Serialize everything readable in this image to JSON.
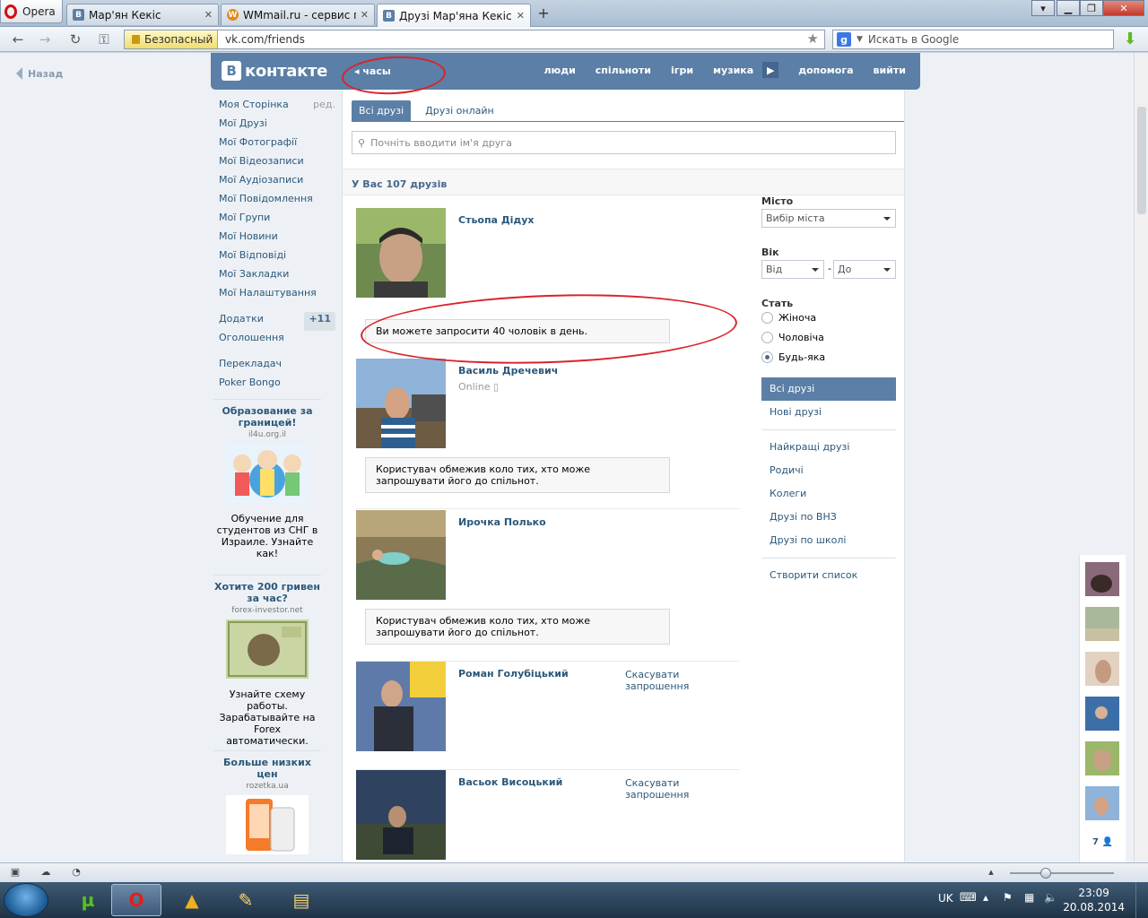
{
  "browser": {
    "menu_label": "Opera",
    "tabs": [
      {
        "title": "Мар'ян Кекіс",
        "favicon": "B"
      },
      {
        "title": "WMmail.ru - сервис п...",
        "favicon": "W"
      },
      {
        "title": "Друзі Мар'яна Кекіса |...",
        "favicon": "B"
      }
    ],
    "secure_label": "Безопасный",
    "url": "vk.com/friends",
    "search_placeholder": "Искать в Google"
  },
  "page": {
    "back_label": "Назад",
    "header": {
      "logo_letter": "B",
      "logo_text": "контакте",
      "status": "часы",
      "nav": [
        "люди",
        "спільноти",
        "ігри",
        "музика",
        "допомога",
        "вийти"
      ]
    },
    "sidebar": {
      "items": [
        {
          "label": "Моя Сторінка",
          "extra": "ред."
        },
        {
          "label": "Мої Друзі"
        },
        {
          "label": "Мої Фотографії"
        },
        {
          "label": "Мої Відеозаписи"
        },
        {
          "label": "Мої Аудіозаписи"
        },
        {
          "label": "Мої Повідомлення"
        },
        {
          "label": "Мої Групи"
        },
        {
          "label": "Мої Новини"
        },
        {
          "label": "Мої Відповіді"
        },
        {
          "label": "Мої Закладки"
        },
        {
          "label": "Мої Налаштування"
        }
      ],
      "apps_label": "Додатки",
      "apps_badge": "+11",
      "ads_label": "Оголошення",
      "translator": "Перекладач",
      "poker": "Poker Bongo"
    },
    "ads": [
      {
        "title": "Образование за границей!",
        "domain": "il4u.org.il",
        "text": "Обучение для студентов из СНГ в Израиле. Узнайте как!"
      },
      {
        "title": "Хотите 200 гривен за час?",
        "domain": "forex-investor.net",
        "text": "Узнайте схему работы. Зарабатывайте на Forex автоматически."
      },
      {
        "title": "Больше низких цен",
        "domain": "rozetka.ua",
        "text": ""
      }
    ],
    "friends_tabs": [
      "Всі друзі",
      "Друзі онлайн"
    ],
    "friend_search_placeholder": "Почніть вводити ім'я друга",
    "friend_count": "У Вас 107 друзів",
    "friends": [
      {
        "name": "Стьопа Дідух",
        "online": "",
        "action": "",
        "notice": "Ви можете запросити 40 чоловік в день."
      },
      {
        "name": "Василь Дречевич",
        "online": "Online",
        "action": "",
        "notice": "Користувач обмежив коло тих, хто може запрошувати його до спільнот."
      },
      {
        "name": "Ирочка Полько",
        "online": "",
        "action": "",
        "notice": "Користувач обмежив коло тих, хто може запрошувати його до спільнот."
      },
      {
        "name": "Роман Голубіцький",
        "online": "",
        "action": "Скасувати запрошення",
        "notice": ""
      },
      {
        "name": "Васьок Висоцький",
        "online": "",
        "action": "Скасувати запрошення",
        "notice": ""
      }
    ],
    "filters": {
      "city_label": "Місто",
      "city_select": "Вибір міста",
      "age_label": "Вік",
      "age_from": "Від",
      "age_dash": "-",
      "age_to": "До",
      "gender_label": "Стать",
      "gender_options": [
        "Жіноча",
        "Чоловіча",
        "Будь-яка"
      ],
      "gender_selected": "Будь-яка",
      "lists_a": [
        "Всі друзі",
        "Нові друзі"
      ],
      "lists_b": [
        "Найкращі друзі",
        "Родичі",
        "Колеги",
        "Друзі по ВНЗ",
        "Друзі по школі"
      ],
      "create_list": "Створити список"
    },
    "online_count": "7"
  },
  "taskbar": {
    "lang": "UK",
    "time": "23:09",
    "date": "20.08.2014"
  },
  "colors": {
    "vk_blue": "#5b7fa6",
    "link": "#2b587a",
    "annotation_red": "#d8232a"
  }
}
